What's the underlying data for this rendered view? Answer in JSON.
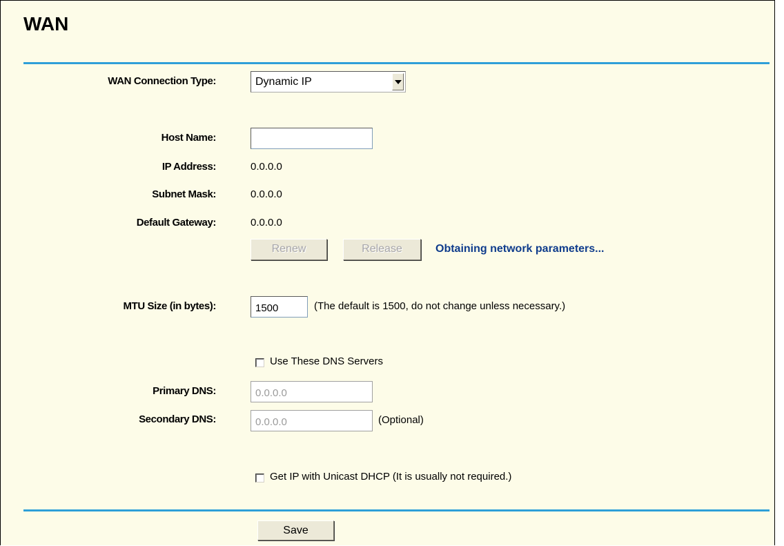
{
  "title": "WAN",
  "connection_type": {
    "label": "WAN Connection Type:",
    "selected": "Dynamic IP"
  },
  "host_name": {
    "label": "Host Name:",
    "value": ""
  },
  "ip_address": {
    "label": "IP Address:",
    "value": "0.0.0.0"
  },
  "subnet_mask": {
    "label": "Subnet Mask:",
    "value": "0.0.0.0"
  },
  "default_gateway": {
    "label": "Default Gateway:",
    "value": "0.0.0.0"
  },
  "buttons": {
    "renew": "Renew",
    "release": "Release",
    "save": "Save"
  },
  "status_text": "Obtaining network parameters...",
  "mtu": {
    "label": "MTU Size (in bytes):",
    "value": "1500",
    "note": "(The default is 1500, do not change unless necessary.)"
  },
  "dns": {
    "use_label": "Use These DNS Servers",
    "use_checked": false,
    "primary_label": "Primary DNS:",
    "primary_value": "0.0.0.0",
    "secondary_label": "Secondary DNS:",
    "secondary_value": "0.0.0.0",
    "secondary_note": "(Optional)"
  },
  "unicast": {
    "label": "Get IP with Unicast DHCP (It is usually not required.)",
    "checked": false
  },
  "colors": {
    "background": "#FDFCE8",
    "rule": "#2E9FD8",
    "status": "#0F3C8C"
  },
  "icons": {
    "dropdown": "chevron-down-icon"
  }
}
